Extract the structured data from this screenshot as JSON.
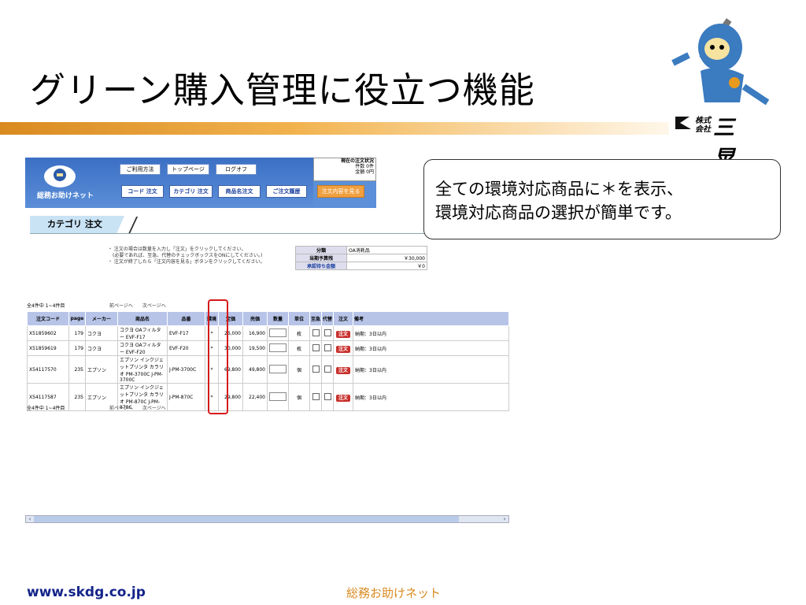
{
  "slide": {
    "title": "グリーン購入管理に役立つ機能",
    "company": {
      "kabushiki": "株式\n会社",
      "name": "三晃堂"
    },
    "footer_url": "www.skdg.co.jp",
    "footer_brand": "総務お助けネット"
  },
  "callout": {
    "line1": "全ての環境対応商品に＊を表示、",
    "line2": "環境対応商品の選択が簡単です。"
  },
  "app": {
    "site_name": "総務お助けネット",
    "top_buttons": [
      "ご利用方法",
      "トップページ",
      "ログオフ"
    ],
    "nav_buttons": [
      "コード 注文",
      "カテゴリ 注文",
      "商品名注文",
      "ご注文履歴",
      "注文内容を見る"
    ],
    "status": {
      "title": "現在の注文状況",
      "count_label": "件数",
      "count": "0件",
      "amount_label": "金額",
      "amount": "0円"
    },
    "page_title": "カテゴリ 注文",
    "notes": [
      "・ 注文の場合は数量を入力し「注文」をクリックしてください。",
      "　(必要であれば、至急、代替のチェックボックスをONにしてください。)",
      "・ 注文が終了したら「注文内容を見る」ボタンをクリックしてください。"
    ],
    "budget": {
      "category_label": "分類",
      "category_value": "OA消耗品",
      "budget_label": "当期予算残",
      "budget_value": "￥30,000",
      "pending_label": "承認待ち金額",
      "pending_value": "￥0"
    },
    "count_text": "全4件中 1~4件目",
    "prev_label": "前ページへ",
    "next_label": "次ページへ",
    "columns": [
      "注文コード",
      "page",
      "メーカー",
      "商品名",
      "品番",
      "環境",
      "定価",
      "売価",
      "数量",
      "単位",
      "至急",
      "代替",
      "注文",
      "備考"
    ],
    "rows": [
      {
        "code": "X51859602",
        "page": "179",
        "maker": "コクヨ",
        "name": "コクヨ OAフィルター EVF-F17",
        "part": "EVF-F17",
        "eco": "*",
        "list": "26,000",
        "sale": "16,900",
        "unit": "枚",
        "order": "注文",
        "note": "納期：3日以内"
      },
      {
        "code": "X51859619",
        "page": "179",
        "maker": "コクヨ",
        "name": "コクヨ OAフィルター EVF-F20",
        "part": "EVF-F20",
        "eco": "*",
        "list": "30,000",
        "sale": "19,500",
        "unit": "枚",
        "order": "注文",
        "note": "納期：3日以内"
      },
      {
        "code": "X54117570",
        "page": "235",
        "maker": "エプソン",
        "name": "エプソン インクジェットプリンタ カラリオ PM-3700C J-PM-3700C",
        "part": "J-PM-3700C",
        "eco": "*",
        "list": "69,800",
        "sale": "49,800",
        "unit": "個",
        "order": "注文",
        "note": "納期：3日以内"
      },
      {
        "code": "X54117587",
        "page": "235",
        "maker": "エプソン",
        "name": "エプソン インクジェットプリンタ カラリオ PM-870C J-PM-870C",
        "part": "J-PM-870C",
        "eco": "*",
        "list": "29,800",
        "sale": "22,400",
        "unit": "個",
        "order": "注文",
        "note": "納期：3日以内"
      }
    ]
  }
}
